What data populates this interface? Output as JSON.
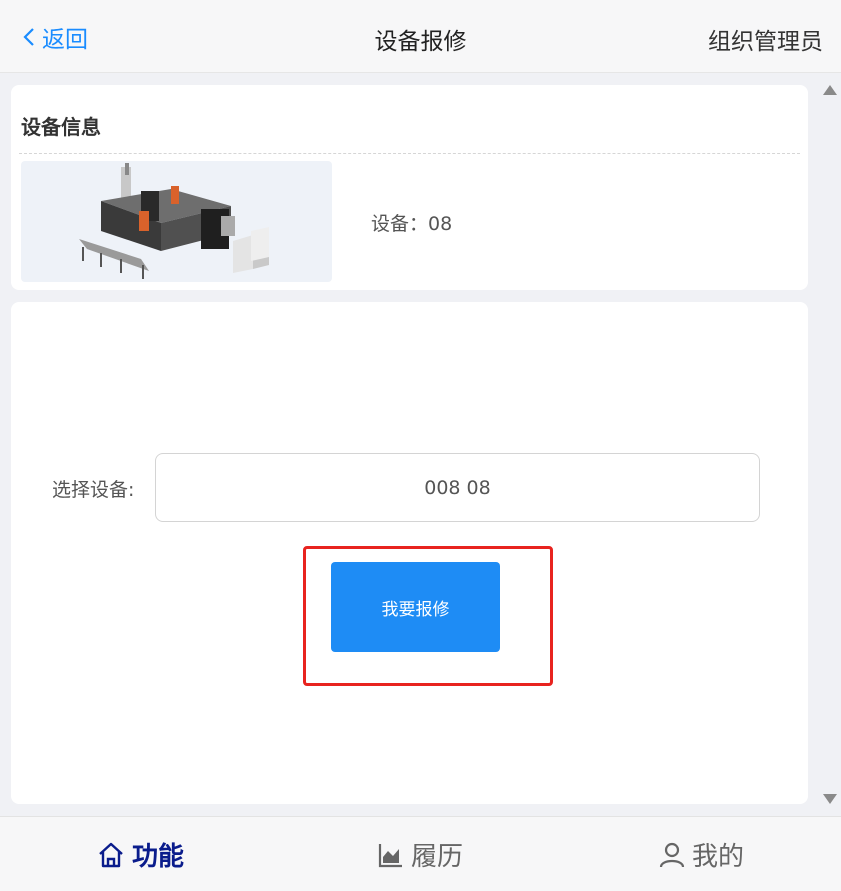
{
  "header": {
    "back_label": "返回",
    "title": "设备报修",
    "role_label": "组织管理员"
  },
  "device_card": {
    "title": "设备信息",
    "device_text": "设备：08"
  },
  "form": {
    "select_label": "选择设备:",
    "selected_value": "008 08",
    "submit_label": "我要报修"
  },
  "tabbar": {
    "tabs": [
      {
        "label": "功能",
        "icon": "home-icon",
        "active": true
      },
      {
        "label": "履历",
        "icon": "area-chart-icon",
        "active": false
      },
      {
        "label": "我的",
        "icon": "user-icon",
        "active": false
      }
    ]
  },
  "colors": {
    "accent": "#1a8cff",
    "button": "#1e8cf5",
    "active_tab": "#0a1c8c",
    "highlight": "#e8231f"
  }
}
